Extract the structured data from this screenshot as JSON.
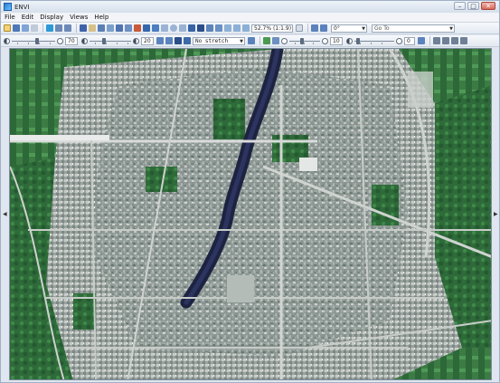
{
  "window": {
    "title": "ENVI"
  },
  "menu": [
    "File",
    "Edit",
    "Display",
    "Views",
    "Help"
  ],
  "toolbar": {
    "scale_readout": "52.7% (1:1.9)",
    "rotation": "0°",
    "goto_placeholder": "Go To"
  },
  "adjust_bar": {
    "brightness": "70",
    "contrast": "20",
    "stretch": "No stretch",
    "sharpen": "10",
    "transparency": "0"
  }
}
